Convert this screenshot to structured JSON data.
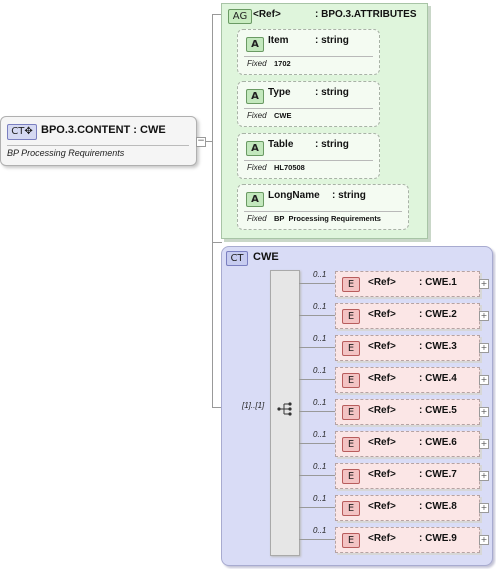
{
  "root": {
    "badge": "CT✥",
    "title": "BPO.3.CONTENT : CWE",
    "documentation": "BP  Processing Requirements",
    "collapse_icon": "minus-icon"
  },
  "attribute_group": {
    "badge": "AG",
    "ref_label": "<Ref>",
    "name": ": BPO.3.ATTRIBUTES",
    "attributes": [
      {
        "badge": "A",
        "name": "Item",
        "type": ": string",
        "fixed_label": "Fixed",
        "fixed_value": "1702"
      },
      {
        "badge": "A",
        "name": "Type",
        "type": ": string",
        "fixed_label": "Fixed",
        "fixed_value": "CWE"
      },
      {
        "badge": "A",
        "name": "Table",
        "type": ": string",
        "fixed_label": "Fixed",
        "fixed_value": "HL70508"
      },
      {
        "badge": "A",
        "name": "LongName",
        "type": ": string",
        "fixed_label": "Fixed",
        "fixed_value": "BP  Processing Requirements"
      }
    ]
  },
  "complex_type": {
    "badge": "CT",
    "name": "CWE",
    "sequence_cardinality": "[1]..[1]",
    "sequence_icon": "sequence-icon",
    "elements": [
      {
        "cardinality": "0..1",
        "badge": "E",
        "ref": "<Ref>",
        "name": ": CWE.1",
        "expand": "+"
      },
      {
        "cardinality": "0..1",
        "badge": "E",
        "ref": "<Ref>",
        "name": ": CWE.2",
        "expand": "+"
      },
      {
        "cardinality": "0..1",
        "badge": "E",
        "ref": "<Ref>",
        "name": ": CWE.3",
        "expand": "+"
      },
      {
        "cardinality": "0..1",
        "badge": "E",
        "ref": "<Ref>",
        "name": ": CWE.4",
        "expand": "+"
      },
      {
        "cardinality": "0..1",
        "badge": "E",
        "ref": "<Ref>",
        "name": ": CWE.5",
        "expand": "+"
      },
      {
        "cardinality": "0..1",
        "badge": "E",
        "ref": "<Ref>",
        "name": ": CWE.6",
        "expand": "+"
      },
      {
        "cardinality": "0..1",
        "badge": "E",
        "ref": "<Ref>",
        "name": ": CWE.7",
        "expand": "+"
      },
      {
        "cardinality": "0..1",
        "badge": "E",
        "ref": "<Ref>",
        "name": ": CWE.8",
        "expand": "+"
      },
      {
        "cardinality": "0..1",
        "badge": "E",
        "ref": "<Ref>",
        "name": ": CWE.9",
        "expand": "+"
      }
    ]
  }
}
